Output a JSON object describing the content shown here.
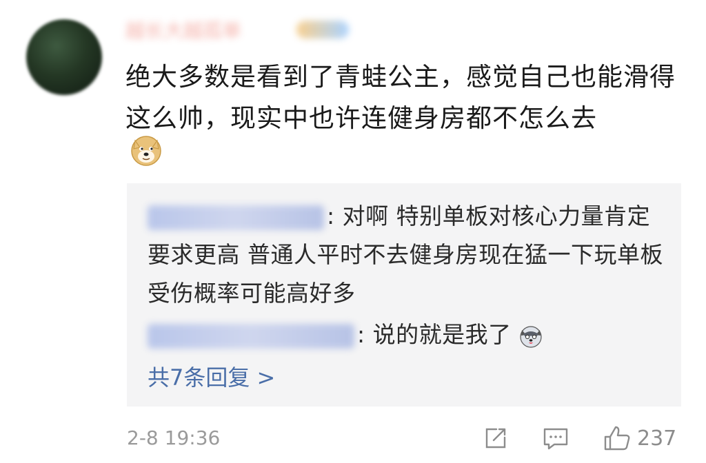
{
  "comment": {
    "author": "越长大越孤单",
    "text": "绝大多数是看到了青蛙公主，感觉自己也能滑得这么帅，现实中也许连健身房都不怎么去",
    "emoji": "doge-emoji"
  },
  "replies": [
    {
      "author": "用户回复者一",
      "separator": ": ",
      "text": "对啊 特别单板对核心力量肯定要求更高 普通人平时不去健身房现在猛一下玩单板受伤概率可能高好多"
    },
    {
      "author": "用户回复者二号",
      "separator": ": ",
      "text": "说的就是我了",
      "emoji": "husky-emoji"
    }
  ],
  "more_replies_label": "共7条回复 >",
  "meta": {
    "timestamp": "2-8 19:36",
    "like_count": "237"
  },
  "icons": {
    "share": "share-icon",
    "comment": "comment-icon",
    "like": "thumbs-up-icon"
  }
}
